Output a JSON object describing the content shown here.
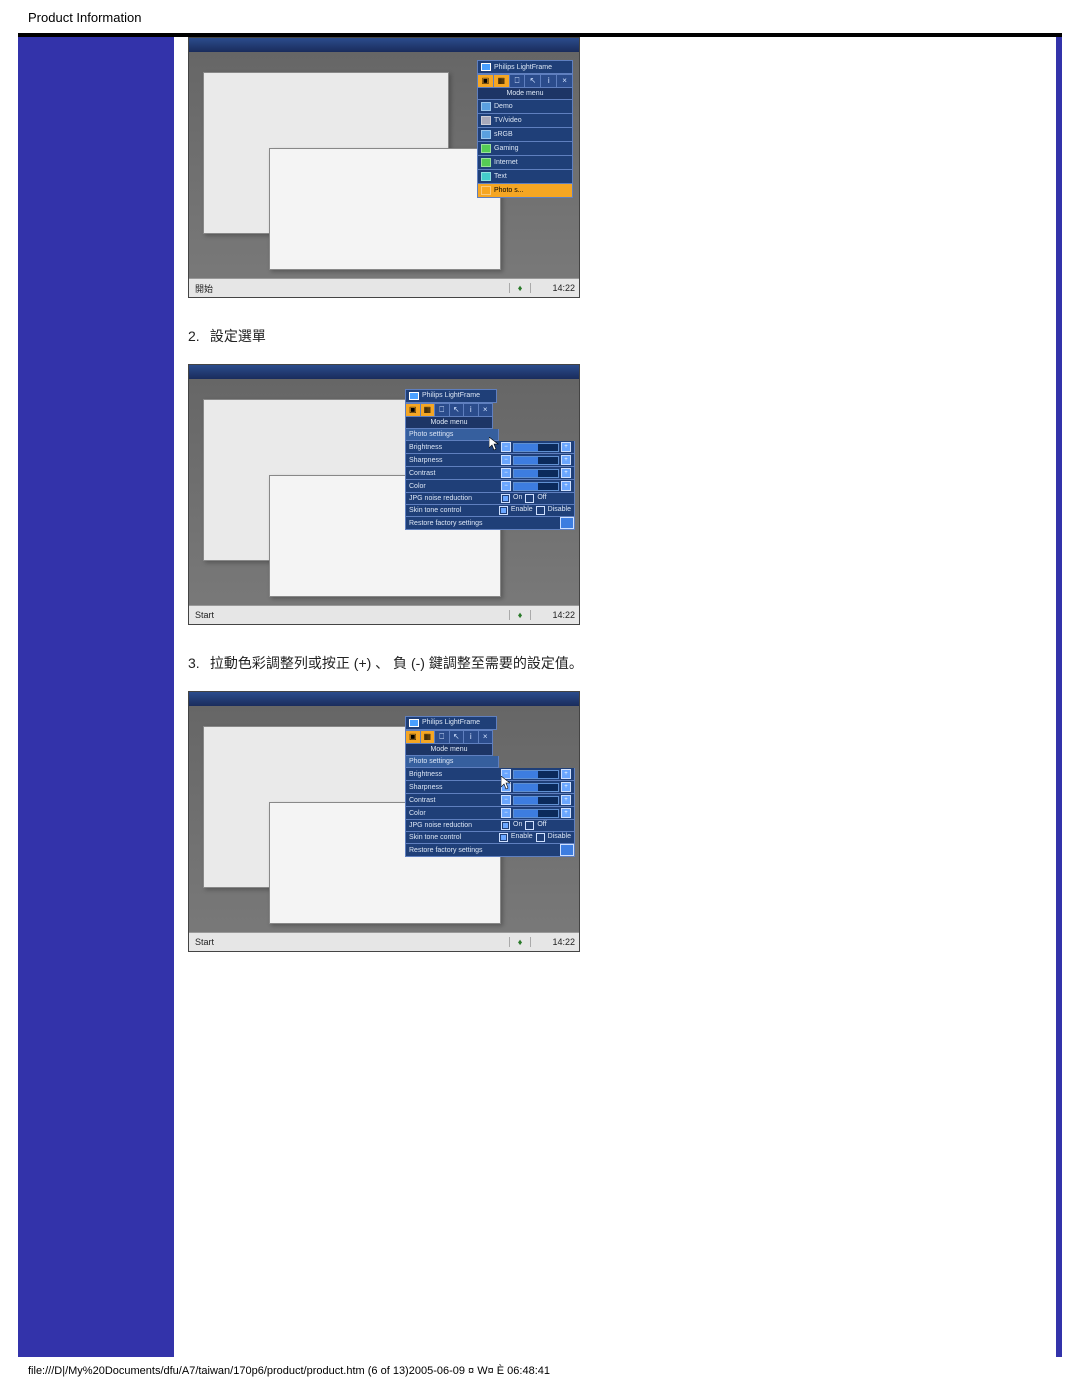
{
  "header": {
    "title": "Product Information"
  },
  "steps": {
    "s2_num": "2.",
    "s2_text": "設定選單",
    "s3_num": "3.",
    "s3_text": "拉動色彩調整列或按正 (+) 、 負 (-) 鍵調整至需要的設定值。"
  },
  "fig1": {
    "panel_title": "Philips LightFrame",
    "mode_header": "Mode menu",
    "items": [
      "Demo",
      "TV/video",
      "sRGB",
      "Gaming",
      "Internet",
      "Text",
      "Photo s..."
    ],
    "taskbar": {
      "start": "開始",
      "clock": "14:22"
    }
  },
  "fig2": {
    "panel_title": "Philips LightFrame",
    "mode_header": "Mode menu",
    "sub_header": "Photo settings",
    "settings": {
      "brightness": "Brightness",
      "sharpness": "Sharpness",
      "contrast": "Contrast",
      "color": "Color",
      "jpg": "JPG noise reduction",
      "skin": "Skin tone control",
      "restore": "Restore factory settings"
    },
    "opts": {
      "on": "On",
      "off": "Off",
      "enable": "Enable",
      "disable": "Disable"
    },
    "taskbar": {
      "start": "Start",
      "clock": "14:22"
    }
  },
  "fig3": {
    "panel_title": "Philips LightFrame",
    "mode_header": "Mode menu",
    "sub_header": "Photo settings",
    "settings": {
      "brightness": "Brightness",
      "sharpness": "Sharpness",
      "contrast": "Contrast",
      "color": "Color",
      "jpg": "JPG noise reduction",
      "skin": "Skin tone control",
      "restore": "Restore factory settings"
    },
    "opts": {
      "on": "On",
      "off": "Off",
      "enable": "Enable",
      "disable": "Disable"
    },
    "taskbar": {
      "start": "Start",
      "clock": "14:22"
    }
  },
  "footer": {
    "path": "file:///D|/My%20Documents/dfu/A7/taiwan/170p6/product/product.htm (6 of 13)2005-06-09 ¤ W¤ È 06:48:41"
  }
}
